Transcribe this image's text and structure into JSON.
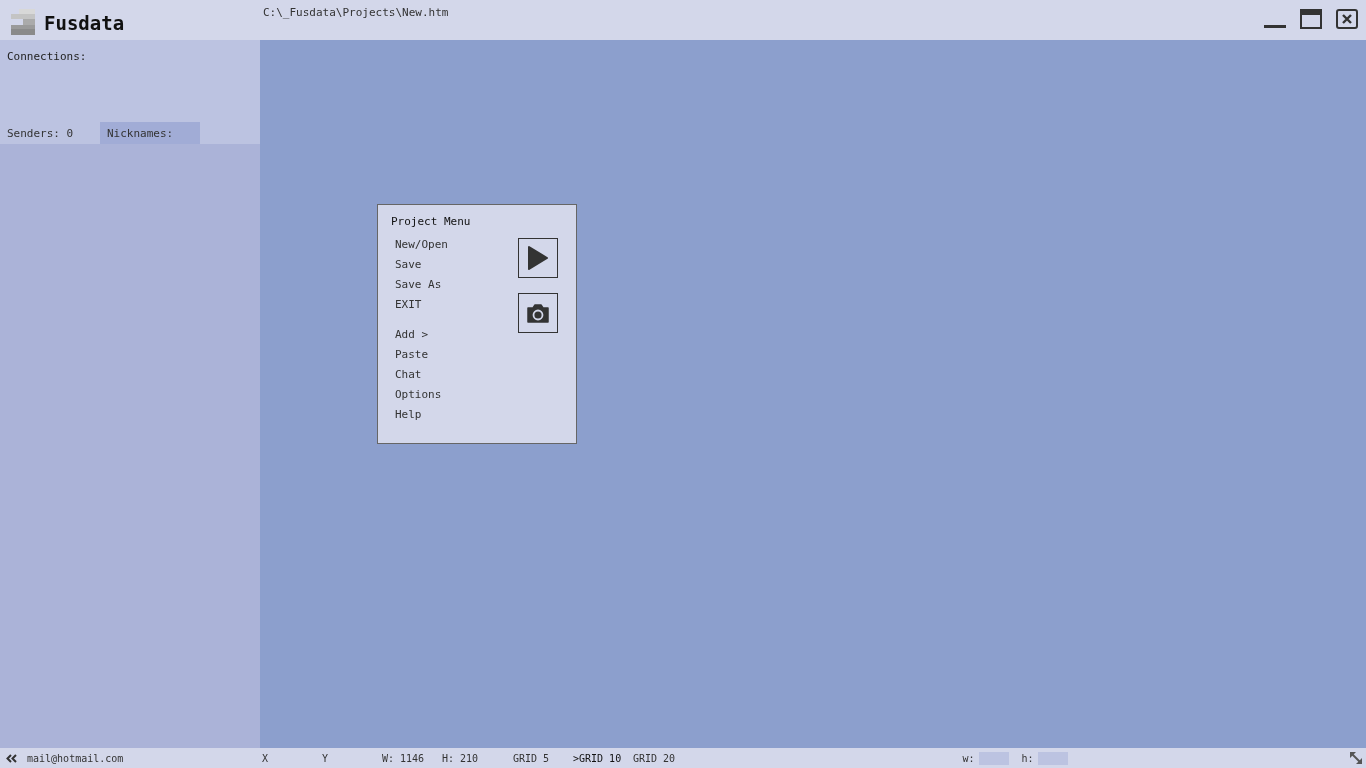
{
  "app": {
    "title": "Fusdata",
    "path": "C:\\_Fusdata\\Projects\\New.htm"
  },
  "sidebar": {
    "connections_label": "Connections:",
    "senders": "Senders: 0",
    "nicknames": "Nicknames:"
  },
  "project_menu": {
    "title": "Project Menu",
    "groups": [
      [
        "New/Open",
        "Save",
        "Save As",
        "EXIT"
      ],
      [
        "Add >",
        "Paste",
        "Chat",
        "Options",
        "Help"
      ]
    ]
  },
  "status_bar": {
    "email": "mail@hotmail.com",
    "x_label": "X",
    "y_label": "Y",
    "width": "W: 1146",
    "height": "H: 210",
    "selected_marker": ">",
    "grids": [
      {
        "label": "GRID 5",
        "selected": false
      },
      {
        "label": "GRID 10",
        "selected": true
      },
      {
        "label": "GRID 20",
        "selected": false
      }
    ],
    "w_label": "w:",
    "h_label": "h:"
  }
}
